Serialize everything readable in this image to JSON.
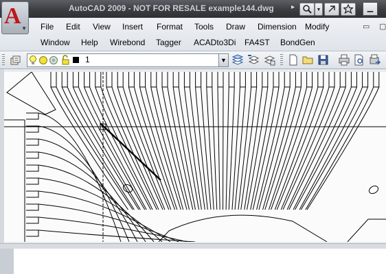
{
  "window": {
    "title": "AutoCAD 2009 - NOT FOR RESALE example144.dwg",
    "app_logo_letter": "A"
  },
  "menu": {
    "row1": [
      "File",
      "Edit",
      "View",
      "Insert",
      "Format",
      "Tools",
      "Draw",
      "Dimension",
      "Modify"
    ],
    "row2": [
      "Window",
      "Help",
      "Wirebond",
      "Tagger",
      "ACADto3Di",
      "FA4ST",
      "BondGen"
    ]
  },
  "layer_toolbar": {
    "current_layer": "1",
    "layer_color": "#000000"
  },
  "colors": {
    "title_bar": "#3b3d41",
    "title_text": "#c9ced5",
    "canvas_background": "#fbfbfb",
    "drawing_lines": "#000000",
    "logo_red": "#c0161b"
  },
  "icons": {
    "search": "search-icon",
    "search_dropdown": "chevron-down-icon",
    "comm_center": "comm-center-icon",
    "favorites": "star-icon",
    "minimize": "minimize-icon",
    "restore": "restore-icon",
    "close": "close-icon",
    "layer_properties": "layer-properties-icon",
    "layer_on": "lightbulb-icon",
    "layer_freeze": "sun-icon",
    "layer_viewport_freeze": "viewport-freeze-icon",
    "layer_lock": "lock-icon",
    "make_current": "make-object-layer-current-icon",
    "previous_layer": "layer-previous-icon",
    "layer_state": "layer-state-icon",
    "new": "new-file-icon",
    "open": "open-folder-icon",
    "save": "save-disk-icon",
    "plot": "printer-icon",
    "plot_preview": "plot-preview-icon",
    "publish": "publish-icon",
    "crosshair": "crosshair-cursor"
  }
}
